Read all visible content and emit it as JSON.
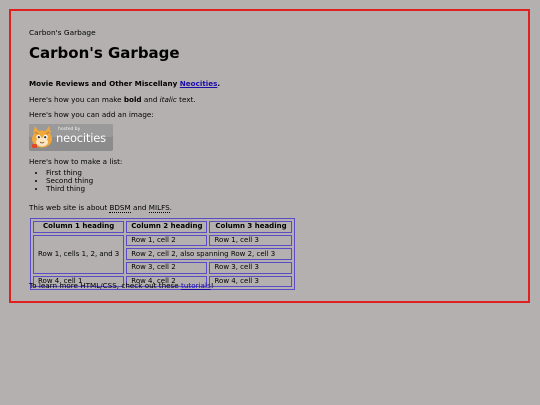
{
  "site": {
    "small_title": "Carbon's Garbage",
    "title": "Carbon's Garbage",
    "tagline_bold": "Movie Reviews and Other Miscellany ",
    "tagline_link": "Neocities",
    "tagline_end": "."
  },
  "paragraphs": {
    "bold_intro": "Here's how you can make ",
    "bold_word": "bold",
    "bold_and": " and ",
    "italic_word": "italic",
    "bold_end": " text.",
    "image_intro": "Here's how you can add an image:",
    "list_intro": "Here's how to make a list:",
    "about_intro": "This web site is about ",
    "about_a": "BDSM",
    "about_and": " and ",
    "about_b": "MILFS",
    "about_end": ".",
    "learn_intro": "To learn more HTML/CSS, check out these ",
    "learn_link": "tutorials",
    "learn_end": "!"
  },
  "badge": {
    "small": "hosted by",
    "big": "neocities"
  },
  "list": [
    "First thing",
    "Second thing",
    "Third thing"
  ],
  "table": {
    "headers": [
      "Column 1 heading",
      "Column 2 heading",
      "Column 3 heading"
    ],
    "r1c1": "Row 1, cells 1, 2, and 3",
    "r1c2": "Row 1, cell 2",
    "r1c3": "Row 1, cell 3",
    "r2c2": "Row 2, cell 2, also spanning Row 2, cell 3",
    "r3c2": "Row 3, cell 2",
    "r3c3": "Row 3, cell 3",
    "r4c1": "Row 4, cell 1",
    "r4c2": "Row 4, cell 2",
    "r4c3": "Row 4, cell 3"
  },
  "colors": {
    "background": "#b4b0b0",
    "frame_border": "#e0201e",
    "table_border": "#5b4bc4",
    "link": "#1a0dab"
  }
}
